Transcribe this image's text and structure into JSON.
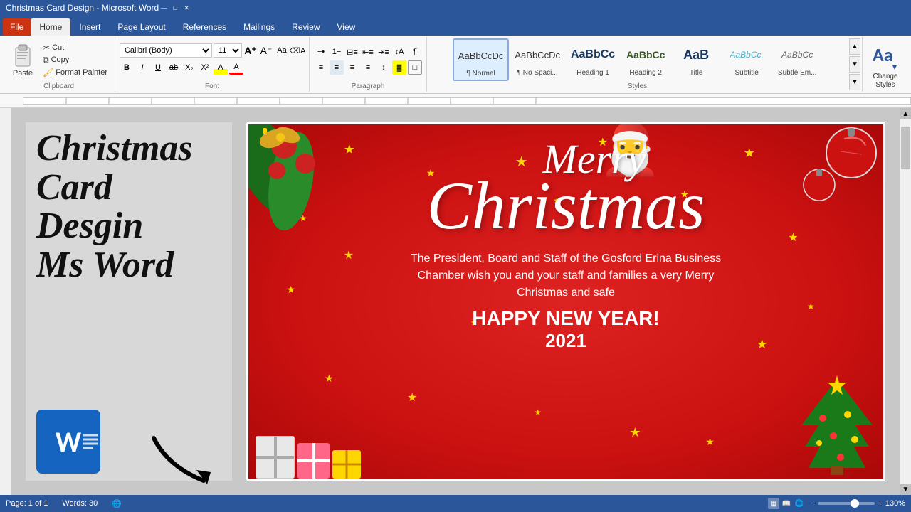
{
  "titlebar": {
    "title": "Christmas Card Design - Microsoft Word",
    "minimize": "—",
    "maximize": "□",
    "close": "✕"
  },
  "ribbon": {
    "tabs": [
      "File",
      "Home",
      "Insert",
      "Page Layout",
      "References",
      "Mailings",
      "Review",
      "View"
    ],
    "active_tab": "Home",
    "groups": {
      "clipboard": {
        "label": "Clipboard",
        "paste": "Paste",
        "cut": "Cut",
        "copy": "Copy",
        "format_painter": "Format Painter"
      },
      "font": {
        "label": "Font",
        "font_name": "Calibri (Body)",
        "font_size": "11"
      },
      "paragraph": {
        "label": "Paragraph"
      },
      "styles": {
        "label": "Styles",
        "items": [
          {
            "label": "¶ Normal",
            "preview": "AaBbCcDc",
            "class": "normal-preview",
            "active": true
          },
          {
            "label": "¶ No Spaci...",
            "preview": "AaBbCcDc",
            "class": "no-spacing-preview",
            "active": false
          },
          {
            "label": "Heading 1",
            "preview": "AaBbCc",
            "class": "h1-preview",
            "active": false
          },
          {
            "label": "Heading 2",
            "preview": "AaBbCc",
            "class": "h2-preview",
            "active": false
          },
          {
            "label": "Title",
            "preview": "AaB",
            "class": "title-preview",
            "active": false
          },
          {
            "label": "Subtitle",
            "preview": "AaBbCc.",
            "class": "subtitle-preview",
            "active": false
          },
          {
            "label": "Subtle Em...",
            "preview": "AaBbCc",
            "class": "subtle-preview",
            "active": false
          }
        ]
      },
      "change_styles": {
        "label": "Change\nStyles",
        "icon": "Aa"
      }
    }
  },
  "document": {
    "left_annotation": {
      "title_line1": "Christmas",
      "title_line2": "Card",
      "title_line3": "Desgin",
      "title_line4": "Ms Word"
    },
    "card": {
      "merry": "Merry",
      "christmas": "Christmas",
      "body": "The President, Board and Staff of the Gosford Erina Business\nChamber wish you and your staff and families a very Merry\nChristmas and safe",
      "happy_new_year": "HAPPY NEW YEAR!",
      "year": "2021"
    }
  },
  "statusbar": {
    "page": "Page: 1 of 1",
    "words": "Words: 30",
    "zoom": "130%"
  }
}
